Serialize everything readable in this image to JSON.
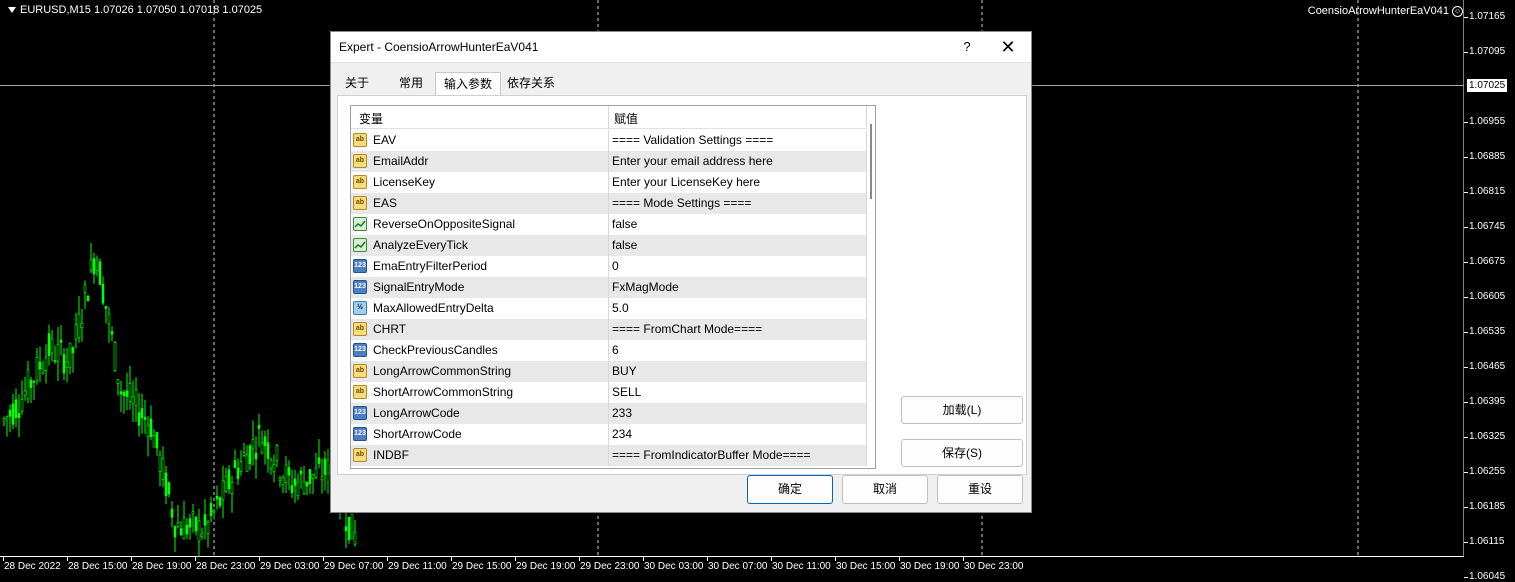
{
  "chart": {
    "symbol_header": "EURUSD,M15  1.07026 1.07050 1.07018 1.07025",
    "ea_label": "CoensioArrowHunterEaV041",
    "current_price": "1.07025",
    "price_labels": [
      "1.07165",
      "1.07095",
      "1.06955",
      "1.06885",
      "1.06815",
      "1.06745",
      "1.06675",
      "1.06605",
      "1.06535",
      "1.06465",
      "1.06395",
      "1.06325",
      "1.06255",
      "1.06185",
      "1.06115",
      "1.06045"
    ],
    "time_labels": [
      "28 Dec 2022",
      "28 Dec 15:00",
      "28 Dec 19:00",
      "28 Dec 23:00",
      "29 Dec 03:00",
      "29 Dec 07:00",
      "29 Dec 11:00",
      "29 Dec 15:00",
      "29 Dec 19:00",
      "29 Dec 23:00",
      "30 Dec 03:00",
      "30 Dec 07:00",
      "30 Dec 11:00",
      "30 Dec 15:00",
      "30 Dec 19:00",
      "30 Dec 23:00"
    ],
    "candle_color": "#00ff00",
    "background": "#000000"
  },
  "dialog": {
    "title": "Expert - CoensioArrowHunterEaV041",
    "help_label": "?",
    "close_label": "✕",
    "tabs": [
      {
        "label": "关于",
        "active": false
      },
      {
        "label": "常用",
        "active": false
      },
      {
        "label": "输入参数",
        "active": true
      },
      {
        "label": "依存关系",
        "active": false
      }
    ],
    "grid": {
      "col_variable": "变量",
      "col_value": "赋值",
      "rows": [
        {
          "icon": "ab",
          "name": "EAV",
          "value": "==== Validation Settings ===="
        },
        {
          "icon": "ab",
          "name": "EmailAddr",
          "value": "Enter your email address here"
        },
        {
          "icon": "ab",
          "name": "LicenseKey",
          "value": "Enter your LicenseKey here"
        },
        {
          "icon": "ab",
          "name": "EAS",
          "value": "==== Mode Settings ===="
        },
        {
          "icon": "bool",
          "name": "ReverseOnOppositeSignal",
          "value": "false"
        },
        {
          "icon": "bool",
          "name": "AnalyzeEveryTick",
          "value": "false"
        },
        {
          "icon": "123",
          "name": "EmaEntryFilterPeriod",
          "value": "0"
        },
        {
          "icon": "123",
          "name": "SignalEntryMode",
          "value": "FxMagMode"
        },
        {
          "icon": "half",
          "name": "MaxAllowedEntryDelta",
          "value": "5.0"
        },
        {
          "icon": "ab",
          "name": "CHRT",
          "value": "==== FromChart Mode===="
        },
        {
          "icon": "123",
          "name": "CheckPreviousCandles",
          "value": "6"
        },
        {
          "icon": "ab",
          "name": "LongArrowCommonString",
          "value": "BUY"
        },
        {
          "icon": "ab",
          "name": "ShortArrowCommonString",
          "value": "SELL"
        },
        {
          "icon": "123",
          "name": "LongArrowCode",
          "value": "233"
        },
        {
          "icon": "123",
          "name": "ShortArrowCode",
          "value": "234"
        },
        {
          "icon": "ab",
          "name": "INDBF",
          "value": "==== FromIndicatorBuffer Mode===="
        }
      ]
    },
    "load_button": "加载(L)",
    "save_button": "保存(S)",
    "ok_button": "确定",
    "cancel_button": "取消",
    "reset_button": "重设"
  }
}
